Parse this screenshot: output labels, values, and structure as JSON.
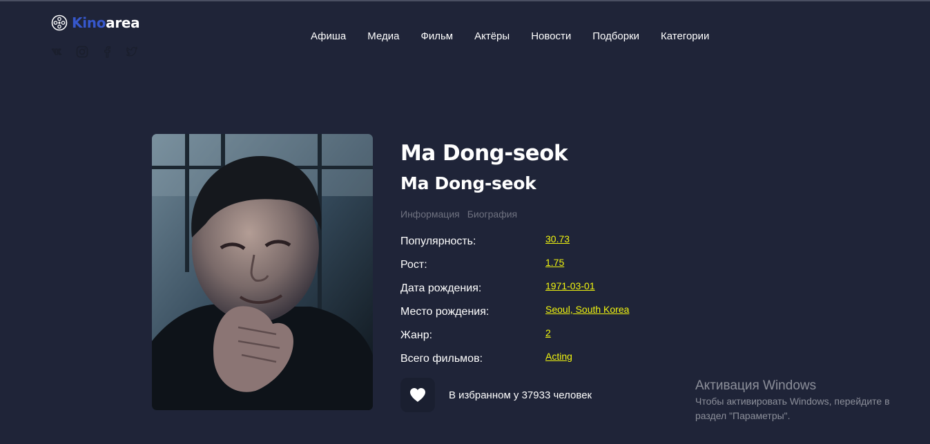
{
  "logo": {
    "accent": "Kino",
    "rest": "area"
  },
  "socials": [
    "vk-icon",
    "instagram-icon",
    "facebook-icon",
    "twitter-icon"
  ],
  "nav": [
    {
      "label": "Афиша"
    },
    {
      "label": "Медиа"
    },
    {
      "label": "Фильм"
    },
    {
      "label": "Актёры"
    },
    {
      "label": "Новости"
    },
    {
      "label": "Подборки"
    },
    {
      "label": "Категории"
    }
  ],
  "actor": {
    "name": "Ma Dong-seok",
    "original_name": "Ma Dong-seok",
    "tabs": [
      {
        "label": "Информация"
      },
      {
        "label": "Биография"
      }
    ],
    "details": [
      {
        "label": "Популярность:",
        "value": "30.73"
      },
      {
        "label": "Рост:",
        "value": "1.75"
      },
      {
        "label": "Дата рождения:",
        "value": "1971-03-01"
      },
      {
        "label": "Место рождения:",
        "value": "Seoul, South Korea"
      },
      {
        "label": "Жанр:",
        "value": "2"
      },
      {
        "label": "Всего фильмов:",
        "value": "Acting"
      }
    ],
    "favorites_text": "В избранном у 37933 человек"
  },
  "watermark": {
    "title": "Активация Windows",
    "line1": "Чтобы активировать Windows, перейдите в",
    "line2": "раздел \"Параметры\"."
  },
  "colors": {
    "background": "#1f2438",
    "brand_accent": "#3657cb",
    "link_yellow": "#f2f60f",
    "muted": "#6f7280"
  }
}
